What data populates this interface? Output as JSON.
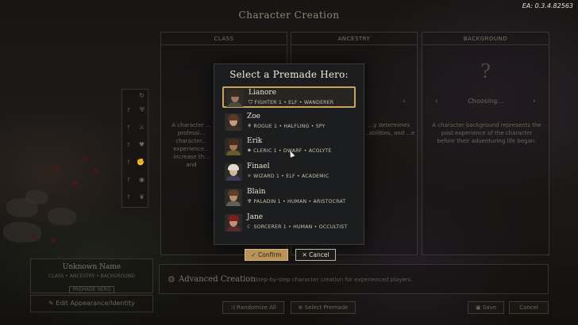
{
  "version": "EA: 0.3.4.82563",
  "screen_title": "Character Creation",
  "columns": {
    "class": {
      "header": "CLASS",
      "description": "A character ... professi... character... experience... increase th... and"
    },
    "ancestry": {
      "header": "ANCESTRY",
      "description": "...y determines ...abilities, and ...e"
    },
    "background": {
      "header": "BACKGROUND",
      "placeholder_glyph": "?",
      "choosing": "Choosing...",
      "description": "A character background represents the past experience of the character before their adventuring life began."
    }
  },
  "slots": [
    {
      "mark": "?",
      "icon": "shield-icon"
    },
    {
      "mark": "?",
      "icon": "sword-icon"
    },
    {
      "mark": "?",
      "icon": "heart-icon"
    },
    {
      "mark": "?",
      "icon": "fist-icon"
    },
    {
      "mark": "?",
      "icon": "eye-icon"
    },
    {
      "mark": "?",
      "icon": "wing-icon"
    }
  ],
  "character": {
    "name": "Unknown Name",
    "summary": "CLASS • ANCESTRY • BACKGROUND",
    "badge": "PREMADE HERO",
    "edit_label": "Edit Appearance/Identity"
  },
  "advanced": {
    "title": "Advanced Creation",
    "description": "Step-by-step character creation for experienced players."
  },
  "footer": {
    "randomize": "Randomize All",
    "select_premade": "Select Premade",
    "save": "Save",
    "cancel": "Cancel"
  },
  "modal": {
    "title": "Select a Premade Hero:",
    "heroes": [
      {
        "name": "Lianore",
        "class_icon": "fighter-icon",
        "details": "FIGHTER 1 • ELF • WANDERER",
        "selected": true,
        "skin": "#9a7660",
        "hair": "#3b2a1f",
        "body": "#4b4a3a"
      },
      {
        "name": "Zoe",
        "class_icon": "rogue-icon",
        "details": "ROGUE 1 • HALFLING • SPY",
        "selected": false,
        "skin": "#c99878",
        "hair": "#5a3a25",
        "body": "#3a3024"
      },
      {
        "name": "Erik",
        "class_icon": "cleric-icon",
        "details": "CLERIC 1 • DWARF • ACOLYTE",
        "selected": false,
        "skin": "#a67450",
        "hair": "#4a2d1a",
        "body": "#6b5a2a"
      },
      {
        "name": "Finael",
        "class_icon": "wizard-icon",
        "details": "WIZARD 1 • ELF • ACADEMIC",
        "selected": false,
        "skin": "#d6b69a",
        "hair": "#e2dccd",
        "body": "#3d3a5a"
      },
      {
        "name": "Blain",
        "class_icon": "paladin-icon",
        "details": "PALADIN 1 • HUMAN • ARISTOCRAT",
        "selected": false,
        "skin": "#b88d6a",
        "hair": "#5c3f26",
        "body": "#5b6154"
      },
      {
        "name": "Jane",
        "class_icon": "sorcerer-icon",
        "details": "SORCERER 1 • HUMAN • OCCULTIST",
        "selected": false,
        "skin": "#c58f75",
        "hair": "#7a1f1c",
        "body": "#5a2a2e"
      }
    ],
    "confirm": "Confirm",
    "cancel": "Cancel"
  },
  "colors": {
    "accent_gold": "#c9a45c",
    "confirm_fill": "#b8945a",
    "modal_bg": "#1c1d1e"
  }
}
